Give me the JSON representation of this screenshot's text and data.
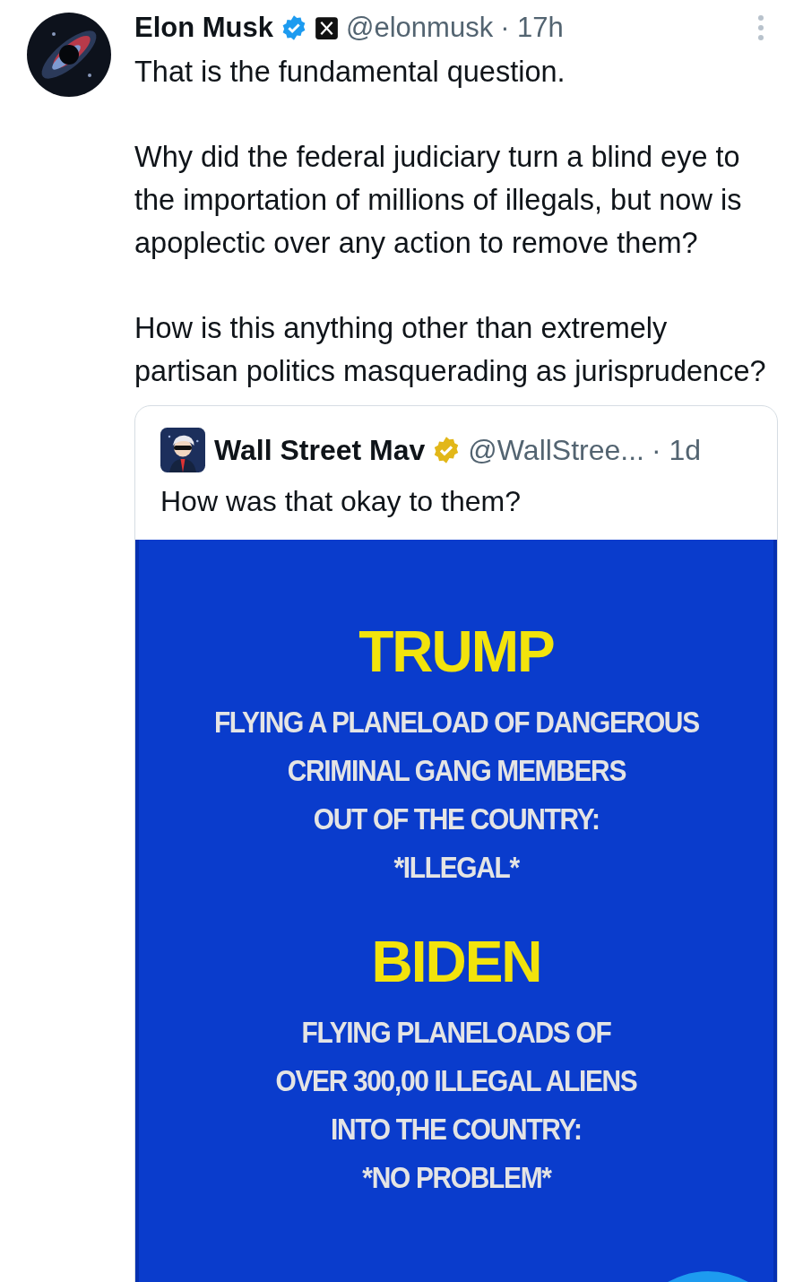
{
  "post": {
    "author": {
      "name": "Elon Musk",
      "badge": {
        "color": "#1d9bf0"
      },
      "affiliated": true,
      "handle": "@elonmusk",
      "time": "· 17h"
    },
    "paragraphs": [
      "That is the fundamental question.",
      "Why did the federal judiciary turn a blind eye to the importation of millions of illegals, but now is apoplectic over any action to remove them?",
      "How is this anything other than extremely partisan politics masquerading as jurisprudence?"
    ],
    "quote": {
      "author": {
        "name": "Wall Street Mav",
        "badge": {
          "color": "#e2b719"
        },
        "handle": "@WallStree...",
        "time": "· 1d"
      },
      "text": "How was that okay to them?",
      "image": {
        "sections": [
          {
            "headline": "TRUMP",
            "lines": [
              "FLYING A PLANELOAD OF DANGEROUS",
              "CRIMINAL GANG MEMBERS",
              "OUT OF THE COUNTRY:",
              "*ILLEGAL*"
            ]
          },
          {
            "headline": "BIDEN",
            "lines": [
              "FLYING PLANELOADS OF",
              "OVER 300,00 ILLEGAL ALIENS",
              "INTO THE COUNTRY:",
              "*NO PROBLEM*"
            ]
          }
        ]
      }
    }
  }
}
